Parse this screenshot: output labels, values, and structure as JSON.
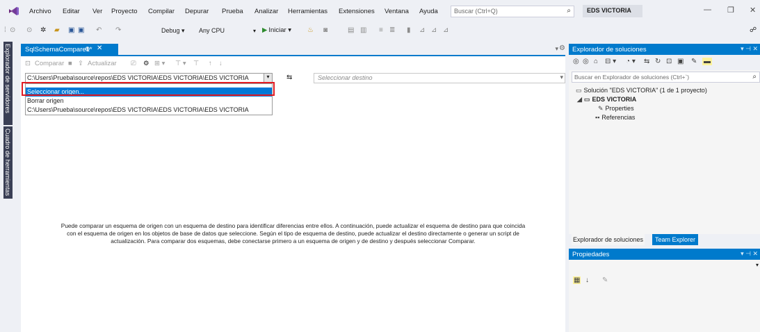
{
  "menu": {
    "items": [
      "Archivo",
      "Editar",
      "Ver",
      "Proyecto",
      "Compilar",
      "Depurar",
      "Prueba",
      "Analizar",
      "Herramientas",
      "Extensiones",
      "Ventana",
      "Ayuda"
    ],
    "search_placeholder": "Buscar (Ctrl+Q)",
    "solution_name": "EDS VICTORIA"
  },
  "toolbar": {
    "config": "Debug",
    "platform": "Any CPU",
    "start_label": "Iniciar"
  },
  "left_tabs": [
    "Explorador de servidores",
    "Cuadro de herramientas"
  ],
  "document": {
    "tab_title": "SqlSchemaCompare1*",
    "compare_label": "Comparar",
    "update_label": "Actualizar",
    "source_value": "C:\\Users\\Prueba\\source\\repos\\EDS VICTORIA\\EDS VICTORIA\\EDS VICTORIA",
    "target_placeholder": "Seleccionar destino",
    "dropdown_options": [
      "Seleccionar origen...",
      "Borrar origen",
      "C:\\Users\\Prueba\\source\\repos\\EDS VICTORIA\\EDS VICTORIA\\EDS VICTORIA"
    ],
    "description_lines": [
      "Puede comparar un esquema de origen con un esquema de destino para identificar diferencias entre ellos. A continuación, puede actualizar el esquema de destino para que coincida",
      "con el esquema de origen en los objetos de base de datos que seleccione. Según el tipo de esquema de destino, puede actualizar el destino directamente o generar un script de",
      "actualización. Para comparar dos esquemas, debe conectarse primero a un esquema de origen y de destino y después seleccionar Comparar."
    ]
  },
  "solution_explorer": {
    "title": "Explorador de soluciones",
    "search_placeholder": "Buscar en Explorador de soluciones (Ctrl+`)",
    "tree": [
      "Solución \"EDS VICTORIA\" (1 de 1 proyecto)",
      "EDS VICTORIA",
      "Properties",
      "Referencias"
    ],
    "bottom_tabs": [
      "Explorador de soluciones",
      "Team Explorer"
    ]
  },
  "properties": {
    "title": "Propiedades"
  },
  "colors": {
    "accent": "#007acc",
    "selection": "#0078d7",
    "highlight_box": "#e21a22"
  }
}
